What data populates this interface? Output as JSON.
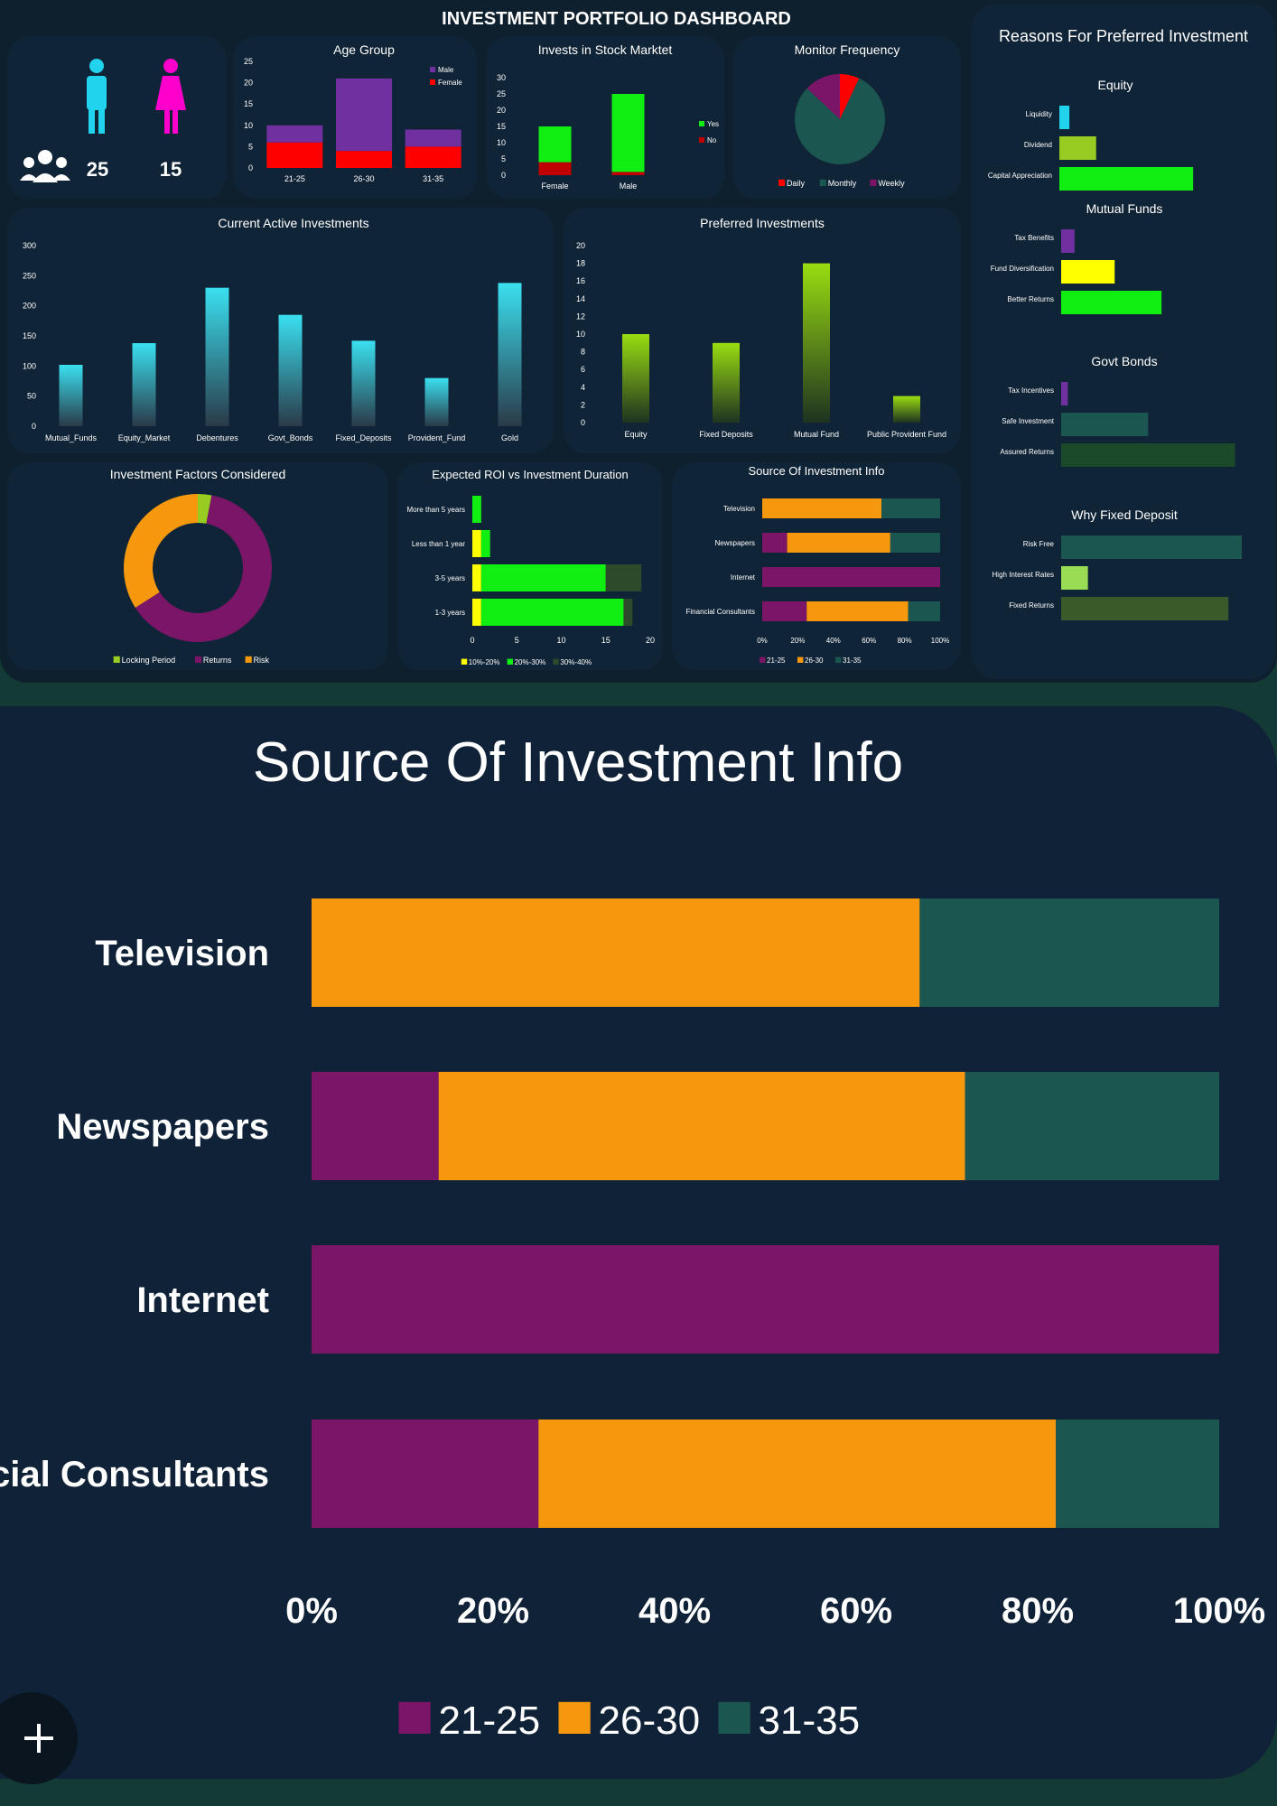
{
  "dashboard": {
    "title": "INVESTMENT PORTFOLIO DASHBOARD",
    "male_count": "25",
    "female_count": "15"
  },
  "colors": {
    "purple": "#7030a0",
    "red": "#ff0000",
    "green": "#11ee11",
    "darkred": "#c00000",
    "teal": "#1c5650",
    "magenta": "#7a1568",
    "orange": "#f5980d",
    "cyan": "#22d3ee",
    "pink": "#ff00cc"
  },
  "chart_data": [
    {
      "id": "age_group",
      "type": "bar",
      "title": "Age Group",
      "categories": [
        "21-25",
        "26-30",
        "31-35"
      ],
      "series": [
        {
          "name": "Male",
          "values": [
            4,
            17,
            4
          ]
        },
        {
          "name": "Female",
          "values": [
            6,
            4,
            5
          ]
        }
      ],
      "ylim": [
        0,
        25
      ],
      "yticks": [
        "25",
        "20",
        "15",
        "10",
        "5",
        "0"
      ]
    },
    {
      "id": "stock_market",
      "type": "bar",
      "title": "Invests in Stock Marktet",
      "categories": [
        "Female",
        "Male"
      ],
      "series": [
        {
          "name": "Yes",
          "values": [
            11,
            24
          ]
        },
        {
          "name": "No",
          "values": [
            4,
            1
          ]
        }
      ],
      "ylim": [
        0,
        30
      ],
      "yticks": [
        "30",
        "25",
        "20",
        "15",
        "10",
        "5",
        "0"
      ]
    },
    {
      "id": "monitor_frequency",
      "type": "pie",
      "title": "Monitor Frequency",
      "labels": [
        "Daily",
        "Monthly",
        "Weekly"
      ],
      "values": [
        7,
        80,
        13
      ]
    },
    {
      "id": "current_active",
      "type": "bar",
      "title": "Current Active Investments",
      "categories": [
        "Mutual_Funds",
        "Equity_Market",
        "Debentures",
        "Govt_Bonds",
        "Fixed_Deposits",
        "Provident_Fund",
        "Gold"
      ],
      "values": [
        102,
        138,
        230,
        185,
        142,
        80,
        238
      ],
      "ylim": [
        0,
        300
      ],
      "yticks": [
        "300",
        "250",
        "200",
        "150",
        "100",
        "50",
        "0"
      ]
    },
    {
      "id": "preferred",
      "type": "bar",
      "title": "Preferred Investments",
      "categories": [
        "Equity",
        "Fixed Deposits",
        "Mutual Fund",
        "Public Provident Fund"
      ],
      "values": [
        10,
        9,
        18,
        3
      ],
      "ylim": [
        0,
        20
      ],
      "yticks": [
        "20",
        "18",
        "16",
        "14",
        "12",
        "10",
        "8",
        "6",
        "4",
        "2",
        "0"
      ]
    },
    {
      "id": "factors",
      "type": "pie",
      "title": "Investment Factors Considered",
      "labels": [
        "Locking Period",
        "Returns",
        "Risk"
      ],
      "values": [
        3,
        63,
        34
      ]
    },
    {
      "id": "roi",
      "type": "bar",
      "title": "Expected ROI vs Investment Duration",
      "categories": [
        "More than 5 years",
        "Less than 1 year",
        "3-5 years",
        "1-3 years"
      ],
      "series": [
        {
          "name": "10%-20%",
          "values": [
            0,
            1,
            1,
            1
          ]
        },
        {
          "name": "20%-30%",
          "values": [
            1,
            1,
            14,
            16
          ]
        },
        {
          "name": "30%-40%",
          "values": [
            0,
            0,
            4,
            1
          ]
        }
      ],
      "xlim": [
        0,
        20
      ],
      "xticks": [
        "0",
        "5",
        "10",
        "15",
        "20"
      ]
    },
    {
      "id": "source_info",
      "type": "bar",
      "title": "Source Of Investment Info",
      "categories": [
        "Television",
        "Newspapers",
        "Internet",
        "Financial Consultants"
      ],
      "series": [
        {
          "name": "21-25",
          "values": [
            0,
            14,
            100,
            25
          ]
        },
        {
          "name": "26-30",
          "values": [
            67,
            58,
            0,
            57
          ]
        },
        {
          "name": "31-35",
          "values": [
            33,
            28,
            0,
            18
          ]
        }
      ],
      "xlim": [
        0,
        100
      ],
      "xticks": [
        "0%",
        "20%",
        "40%",
        "60%",
        "80%",
        "100%"
      ]
    },
    {
      "id": "reasons",
      "type": "bar",
      "title": "Reasons For Preferred Investment",
      "groups": [
        {
          "title": "Equity",
          "labels": [
            "Liquidity",
            "Dividend",
            "Capital Appreciation"
          ],
          "values": [
            1.5,
            5.5,
            20
          ],
          "colors": [
            "#22d3ee",
            "#99cc22",
            "#11ee11"
          ]
        },
        {
          "title": "Mutual Funds",
          "labels": [
            "Tax Benefits",
            "Fund Diversification",
            "Better Returns"
          ],
          "values": [
            2,
            8,
            15
          ],
          "colors": [
            "#7030a0",
            "#ffff00",
            "#11ee11"
          ]
        },
        {
          "title": "Govt Bonds",
          "labels": [
            "Tax Incentives",
            "Safe Investment",
            "Assured Returns"
          ],
          "values": [
            1,
            13,
            26
          ],
          "colors": [
            "#7030a0",
            "#1c5650",
            "#1a4a2a"
          ]
        },
        {
          "title": "Why Fixed Deposit",
          "labels": [
            "Risk Free",
            "High Interest Rates",
            "Fixed Returns"
          ],
          "values": [
            27,
            4,
            25
          ],
          "colors": [
            "#1c5650",
            "#99dd55",
            "#3a5a2a"
          ]
        }
      ]
    }
  ]
}
